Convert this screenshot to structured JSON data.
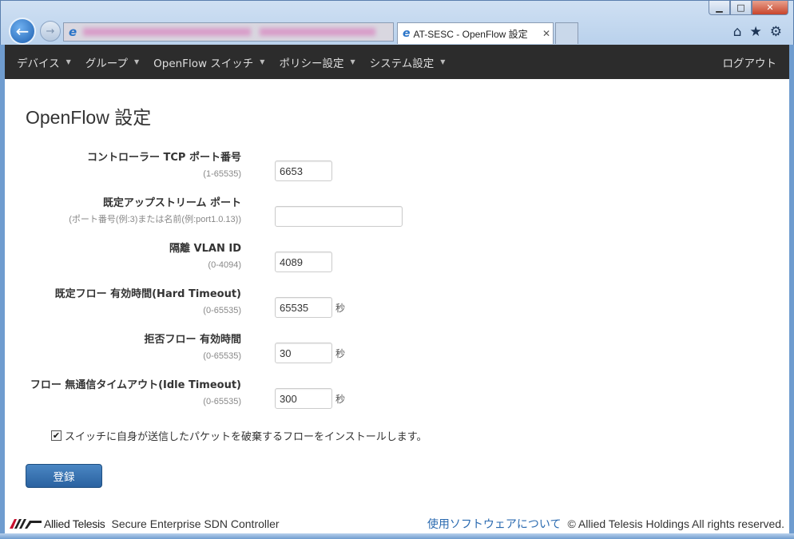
{
  "browser": {
    "tab_title": "AT-SESC - OpenFlow 設定",
    "tab_close": "✕",
    "window_buttons": {
      "minimize": "▁",
      "maximize": "□",
      "close": "✕"
    },
    "icons": {
      "home": "home-icon",
      "favorites": "star-icon",
      "tools": "gear-icon"
    }
  },
  "navbar": {
    "items": [
      {
        "label": "デバイス"
      },
      {
        "label": "グループ"
      },
      {
        "label": "OpenFlow スイッチ"
      },
      {
        "label": "ポリシー設定"
      },
      {
        "label": "システム設定"
      }
    ],
    "logout": "ログアウト"
  },
  "page": {
    "title": "OpenFlow 設定"
  },
  "form": {
    "fields": [
      {
        "label": "コントローラー TCP ポート番号",
        "range": "(1-65535)",
        "value": "6653",
        "unit": ""
      },
      {
        "label": "既定アップストリーム ポート",
        "range": "(ポート番号(例:3)または名前(例:port1.0.13))",
        "value": "",
        "unit": ""
      },
      {
        "label": "隔離 VLAN ID",
        "range": "(0-4094)",
        "value": "4089",
        "unit": ""
      },
      {
        "label": "既定フロー 有効時間(Hard Timeout)",
        "range": "(0-65535)",
        "value": "65535",
        "unit": "秒"
      },
      {
        "label": "拒否フロー 有効時間",
        "range": "(0-65535)",
        "value": "30",
        "unit": "秒"
      },
      {
        "label": "フロー 無通信タイムアウト(Idle Timeout)",
        "range": "(0-65535)",
        "value": "300",
        "unit": "秒"
      }
    ],
    "checkbox_label": "スイッチに自身が送信したパケットを破棄するフローをインストールします。",
    "checkbox_checked": true,
    "submit_label": "登録"
  },
  "footer": {
    "logo_text": "Allied Telesis",
    "product": "Secure Enterprise SDN Controller",
    "link": "使用ソフトウェアについて",
    "copyright": "© Allied Telesis Holdings All rights reserved."
  }
}
